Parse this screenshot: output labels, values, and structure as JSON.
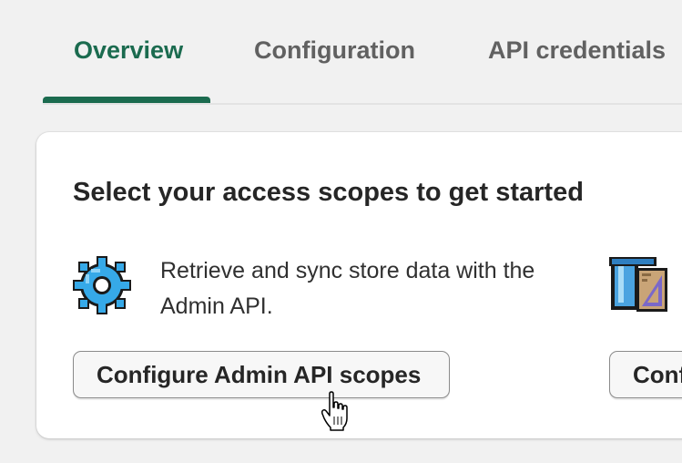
{
  "tabs": [
    {
      "label": "Overview",
      "active": true
    },
    {
      "label": "Configuration",
      "active": false
    },
    {
      "label": "API credentials",
      "active": false
    }
  ],
  "card": {
    "title": "Select your access scopes to get started",
    "admin_scope": {
      "icon": "gear-icon",
      "description": "Retrieve and sync store data with the Admin API.",
      "button_label": "Configure Admin API scopes"
    },
    "second_scope": {
      "icon": "design-tools-icon",
      "button_label": "Conf"
    }
  },
  "colors": {
    "accent": "#1b6b4f",
    "background": "#f1f1f1",
    "card": "#ffffff"
  }
}
